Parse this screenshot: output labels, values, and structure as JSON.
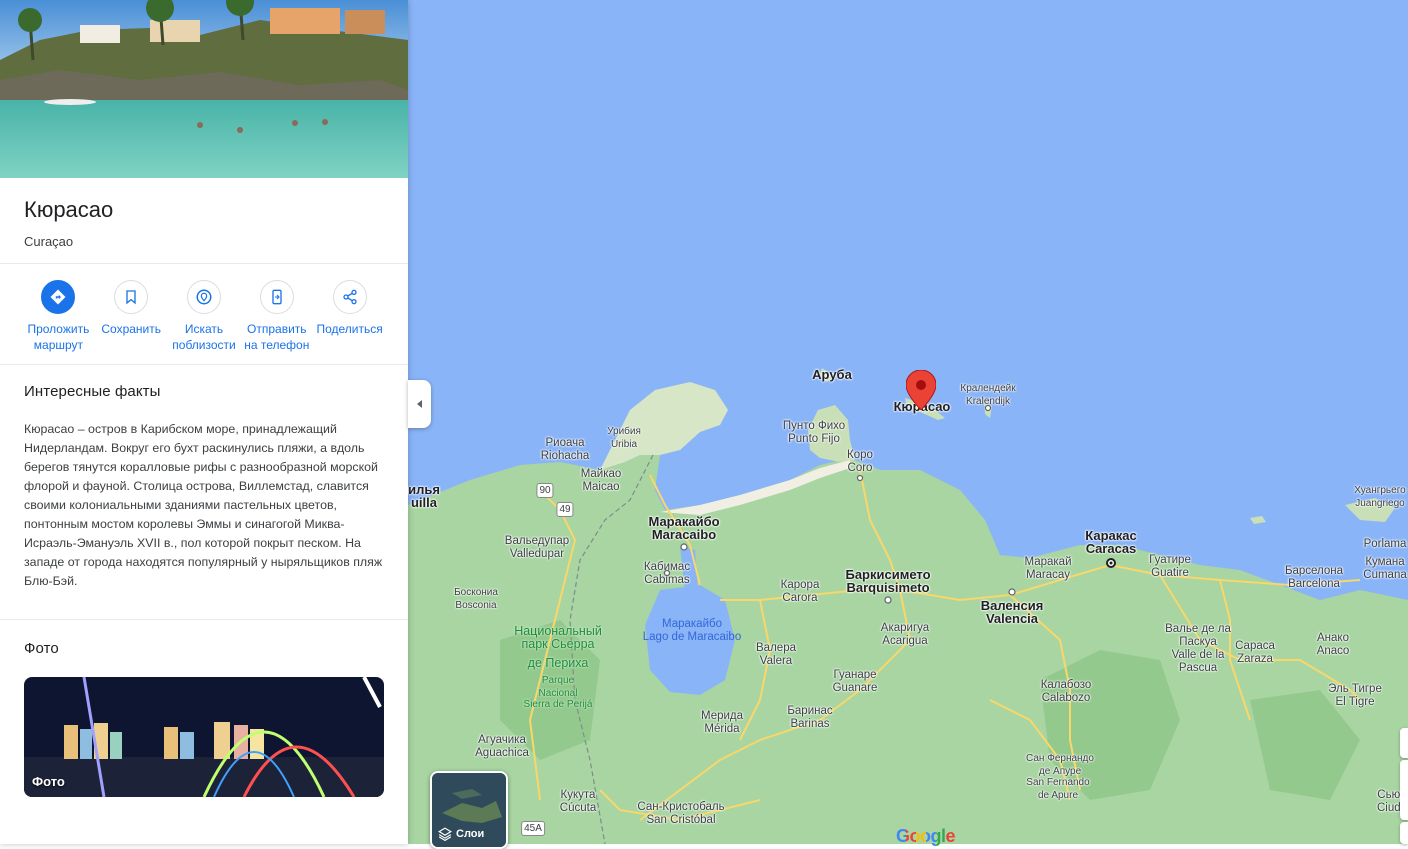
{
  "place": {
    "title": "Кюрасао",
    "subtitle": "Curaçao"
  },
  "actions": [
    {
      "label": "Проложить маршрут",
      "icon": "directions-icon"
    },
    {
      "label": "Сохранить",
      "icon": "bookmark-icon"
    },
    {
      "label": "Искать поблизости",
      "icon": "nearby-icon"
    },
    {
      "label": "Отправить на телефон",
      "icon": "send-to-phone-icon"
    },
    {
      "label": "Поделиться",
      "icon": "share-icon"
    }
  ],
  "facts": {
    "title": "Интересные факты",
    "text": "Кюрасао – остров в Карибском море, принадлежащий Нидерландам. Вокруг его бухт раскинулись пляжи, а вдоль берегов тянутся коралловые рифы с разнообразной морской флорой и фауной. Столица острова, Виллемстад, славится своими колониальными зданиями пастельных цветов, понтонным мостом королевы Эммы и синагогой Миква-Исраэль-Эмануэль XVII в., пол которой покрыт песком. На западе от города находятся популярный у ныряльщиков пляж Блю-Бэй."
  },
  "photos": {
    "title": "Фото",
    "card_label": "Фото"
  },
  "map": {
    "layers_label": "Слои",
    "logo_text": "Google",
    "colors": {
      "sea": "#8ab4f8",
      "land": "#a8d5a2",
      "land_dark": "#94c98d",
      "desert": "#e8e4d0",
      "road": "#f9d76a",
      "pin": "#ea4335",
      "accent": "#1a73e8"
    },
    "labels": [
      {
        "id": "aruba",
        "text": "Аруба",
        "sub": "",
        "kind": "big"
      },
      {
        "id": "curacao",
        "text": "Кюрасао",
        "sub": "",
        "kind": "big"
      },
      {
        "id": "kralendijk",
        "text": "Кралендейк",
        "sub": "Kralendijk",
        "kind": "small"
      },
      {
        "id": "punto-fijo",
        "text": "Пунто Фихо",
        "sub": "Punto Fijo",
        "kind": "normal"
      },
      {
        "id": "coro",
        "text": "Коро",
        "sub": "Coro",
        "kind": "normal"
      },
      {
        "id": "uribia",
        "text": "Урибия",
        "sub": "Uribia",
        "kind": "small"
      },
      {
        "id": "riohacha",
        "text": "Риоача",
        "sub": "Riohacha",
        "kind": "normal"
      },
      {
        "id": "maicao",
        "text": "Майкао",
        "sub": "Maicao",
        "kind": "normal"
      },
      {
        "id": "maracaibo",
        "text": "Маракайбо",
        "sub": "Maracaibo",
        "kind": "big"
      },
      {
        "id": "valledupar",
        "text": "Вальедупар",
        "sub": "Valledupar",
        "kind": "normal"
      },
      {
        "id": "cabimas",
        "text": "Кабимас",
        "sub": "Cabimas",
        "kind": "normal"
      },
      {
        "id": "lake-maracaibo",
        "text": "Маракайбо",
        "sub": "Lago de Maracaibo",
        "kind": "lake"
      },
      {
        "id": "bosconia",
        "text": "Боскониа",
        "sub": "Bosconia",
        "kind": "small"
      },
      {
        "id": "national-park",
        "text": "Национальный",
        "sub": "парк Сьерра",
        "kind": "park"
      },
      {
        "id": "national-park-2",
        "text": "де Периха",
        "sub": "",
        "kind": "park"
      },
      {
        "id": "parque",
        "text": "Parque",
        "sub": "Nacional",
        "kind": "park-small"
      },
      {
        "id": "parque-2",
        "text": "Sierra de Perijá",
        "sub": "",
        "kind": "park-small"
      },
      {
        "id": "barquisimeto",
        "text": "Баркисимето",
        "sub": "Barquisimeto",
        "kind": "big"
      },
      {
        "id": "carora",
        "text": "Карора",
        "sub": "Carora",
        "kind": "normal"
      },
      {
        "id": "valencia",
        "text": "Валенсия",
        "sub": "Valencia",
        "kind": "big"
      },
      {
        "id": "maracay",
        "text": "Маракай",
        "sub": "Maracay",
        "kind": "normal"
      },
      {
        "id": "caracas",
        "text": "Каракас",
        "sub": "Caracas",
        "kind": "big"
      },
      {
        "id": "guatire",
        "text": "Гуатире",
        "sub": "Guatire",
        "kind": "normal"
      },
      {
        "id": "barcelona",
        "text": "Барселона",
        "sub": "Barcelona",
        "kind": "normal"
      },
      {
        "id": "acarigua",
        "text": "Акаригуа",
        "sub": "Acarigua",
        "kind": "normal"
      },
      {
        "id": "valera",
        "text": "Валера",
        "sub": "Valera",
        "kind": "normal"
      },
      {
        "id": "guanare",
        "text": "Гуанаре",
        "sub": "Guanare",
        "kind": "normal"
      },
      {
        "id": "barinas",
        "text": "Баринас",
        "sub": "Barinas",
        "kind": "normal"
      },
      {
        "id": "merida",
        "text": "Мерида",
        "sub": "Mérida",
        "kind": "normal"
      },
      {
        "id": "aguachica",
        "text": "Агуачика",
        "sub": "Aguachica",
        "kind": "normal"
      },
      {
        "id": "cucuta",
        "text": "Кукута",
        "sub": "Cúcuta",
        "kind": "normal"
      },
      {
        "id": "san-cristobal",
        "text": "Сан-Кристобаль",
        "sub": "San Cristóbal",
        "kind": "normal"
      },
      {
        "id": "calabozo",
        "text": "Калабозо",
        "sub": "Calabozo",
        "kind": "normal"
      },
      {
        "id": "valle-pascua",
        "text": "Валье де ла Паскуа",
        "sub": "Valle de la Pascua",
        "kind": "normal"
      },
      {
        "id": "zaraza",
        "text": "Сараса",
        "sub": "Zaraza",
        "kind": "normal"
      },
      {
        "id": "anaco",
        "text": "Анако",
        "sub": "Anaco",
        "kind": "normal"
      },
      {
        "id": "el-tigre",
        "text": "Эль Тигре",
        "sub": "El Tigre",
        "kind": "normal"
      },
      {
        "id": "san-fernando",
        "text": "Сан Фернандо",
        "sub": "де Апуре",
        "kind": "small"
      },
      {
        "id": "san-fernando-2",
        "text": "San Fernando",
        "sub": "de Apure",
        "kind": "small"
      },
      {
        "id": "juangriego",
        "text": "Хуангрьего",
        "sub": "Juangriego",
        "kind": "small"
      },
      {
        "id": "porlamar",
        "text": "Porlama",
        "sub": "",
        "kind": "normal"
      },
      {
        "id": "cumana",
        "text": "Кумана",
        "sub": "Cumana",
        "kind": "normal"
      },
      {
        "id": "ciudad",
        "text": "Сьюд",
        "sub": "Ciuda",
        "kind": "normal"
      },
      {
        "id": "left-edge",
        "text": "илья",
        "sub": "uilla",
        "kind": "big"
      },
      {
        "id": "route-90",
        "text": "90",
        "sub": "",
        "kind": "shield"
      },
      {
        "id": "route-49",
        "text": "49",
        "sub": "",
        "kind": "shield"
      },
      {
        "id": "route-45a",
        "text": "45A",
        "sub": "",
        "kind": "shield"
      }
    ]
  }
}
